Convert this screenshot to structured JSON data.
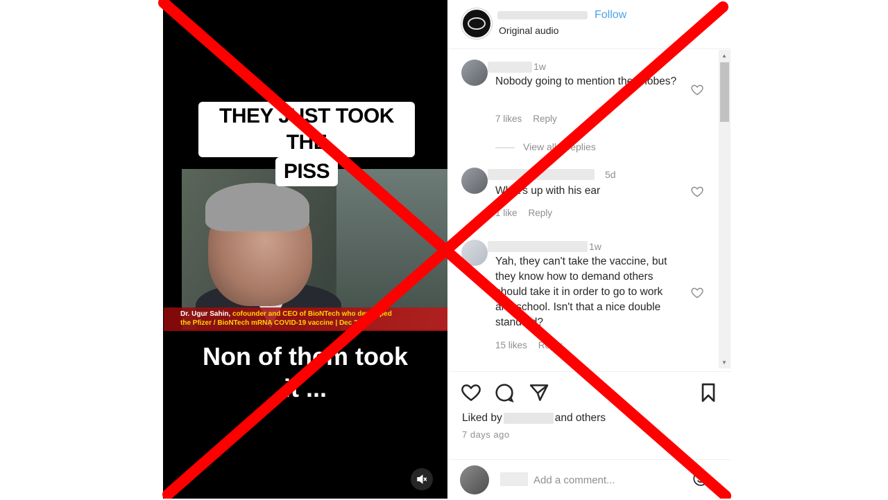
{
  "video": {
    "caption_top": [
      "THEY JUST TOOK THE",
      "PISS"
    ],
    "lower_third": {
      "line1_name": "Dr. Ugur Sahin,",
      "line1_rest": " cofounder and CEO of BioNTech who developed",
      "line2": "the Pfizer / BioNTech mRNA COVID-19 vaccine | Dec 2021"
    },
    "caption_bottom": [
      "Non of them took",
      "it ..."
    ]
  },
  "header": {
    "follow_label": "Follow",
    "audio_label": "Original audio"
  },
  "comments": [
    {
      "time": "1w",
      "text": "Nobody going to mention them lobes?",
      "likes": "7 likes",
      "reply": "Reply"
    },
    {
      "time": "5d",
      "text": "What's up with his ear",
      "likes": "1 like",
      "reply": "Reply"
    },
    {
      "time": "1w",
      "text": "Yah, they can't take the vaccine, but they know how to demand others should take it in order to go to work and school. Isn't that a nice double standard?",
      "likes": "15 likes",
      "reply": "Reply"
    }
  ],
  "view_replies_label": "View all 1 replies",
  "actions": {
    "liked_prefix": "Liked by",
    "liked_suffix": "and others",
    "post_time": "7 days ago",
    "comment_placeholder": "Add a comment..."
  },
  "icons": {
    "like": "heart-icon",
    "comment": "comment-bubble-icon",
    "share": "send-icon",
    "save": "bookmark-icon",
    "mute": "speaker-muted-icon",
    "emoji": "emoji-icon"
  },
  "colors": {
    "follow_blue": "#4aa3ea",
    "overlay_red": "#ff0000",
    "muted_text": "#8e8e8e"
  }
}
